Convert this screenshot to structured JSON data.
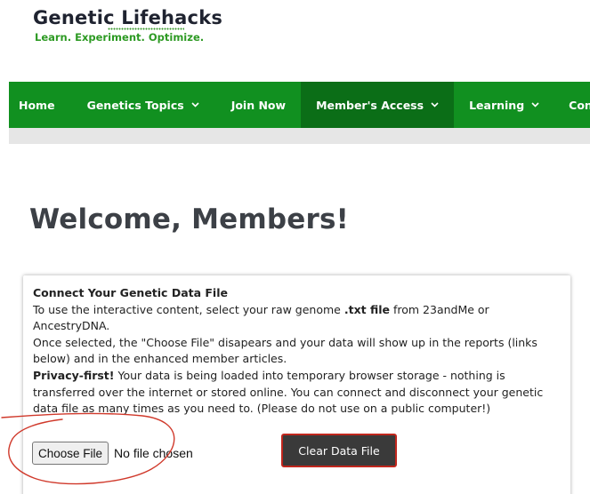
{
  "logo": {
    "title": "Genetic Lifehacks",
    "tagline": "Learn. Experiment. Optimize."
  },
  "nav": {
    "items": [
      {
        "label": "Home",
        "has_dropdown": false,
        "active": false
      },
      {
        "label": "Genetics Topics",
        "has_dropdown": true,
        "active": false
      },
      {
        "label": "Join Now",
        "has_dropdown": false,
        "active": false
      },
      {
        "label": "Member's Access",
        "has_dropdown": true,
        "active": true
      },
      {
        "label": "Learning",
        "has_dropdown": true,
        "active": false
      },
      {
        "label": "Consu",
        "has_dropdown": false,
        "active": false
      }
    ],
    "icon": "chevron-down-icon"
  },
  "page": {
    "heading": "Welcome, Members!"
  },
  "card": {
    "title": "Connect Your Genetic Data File",
    "p1_a": "To use the interactive content, select your raw genome ",
    "p1_b": ".txt file",
    "p1_c": " from 23andMe or AncestryDNA.",
    "p2": "Once selected, the \"Choose File\" disapears and your data will show up in the reports (links below) and in the enhanced member articles.",
    "p3_a": "Privacy-first!",
    "p3_b": " Your data is being loaded into temporary browser storage - nothing is transferred over the internet or stored online. You can connect and disconnect your genetic data file as many times as you need to. (Please do not use on a public computer!)",
    "choose_label": "Choose File",
    "no_file": "No file chosen",
    "clear_label": "Clear Data File"
  },
  "colors": {
    "nav_green": "#119020",
    "nav_active": "#0b6e17",
    "tagline_green": "#2d9a23",
    "annotation_red": "#d0392b",
    "clear_button_bg": "#3a3a3a"
  }
}
